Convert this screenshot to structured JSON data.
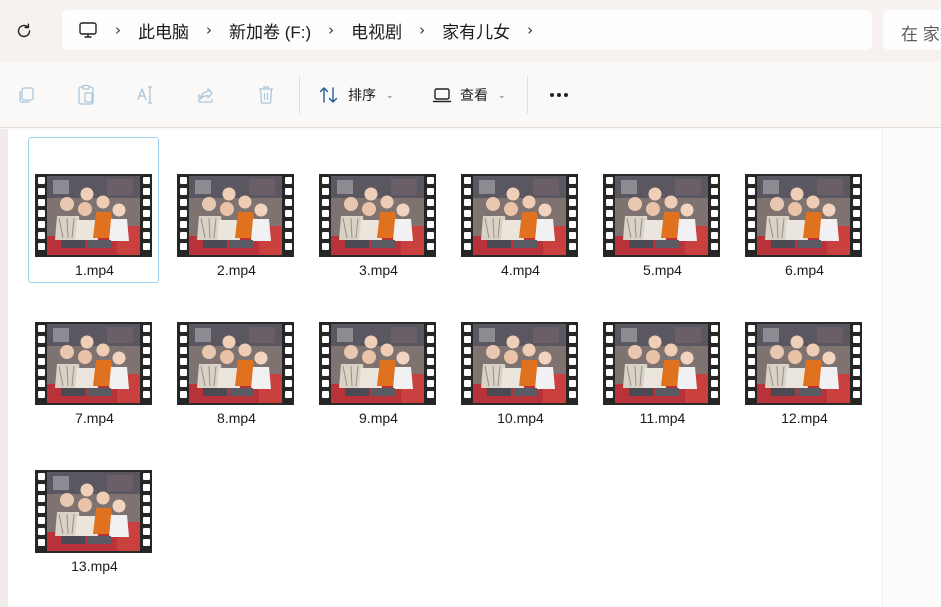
{
  "address_bar": {
    "breadcrumbs": [
      "此电脑",
      "新加卷 (F:)",
      "电视剧",
      "家有儿女"
    ],
    "search_placeholder": "在 家有儿女 中搜索"
  },
  "toolbar": {
    "sort_label": "排序",
    "view_label": "查看"
  },
  "files": [
    {
      "name": "1.mp4",
      "selected": true
    },
    {
      "name": "2.mp4"
    },
    {
      "name": "3.mp4"
    },
    {
      "name": "4.mp4"
    },
    {
      "name": "5.mp4"
    },
    {
      "name": "6.mp4"
    },
    {
      "name": "7.mp4"
    },
    {
      "name": "8.mp4"
    },
    {
      "name": "9.mp4"
    },
    {
      "name": "10.mp4"
    },
    {
      "name": "11.mp4"
    },
    {
      "name": "12.mp4"
    },
    {
      "name": "13.mp4"
    }
  ]
}
